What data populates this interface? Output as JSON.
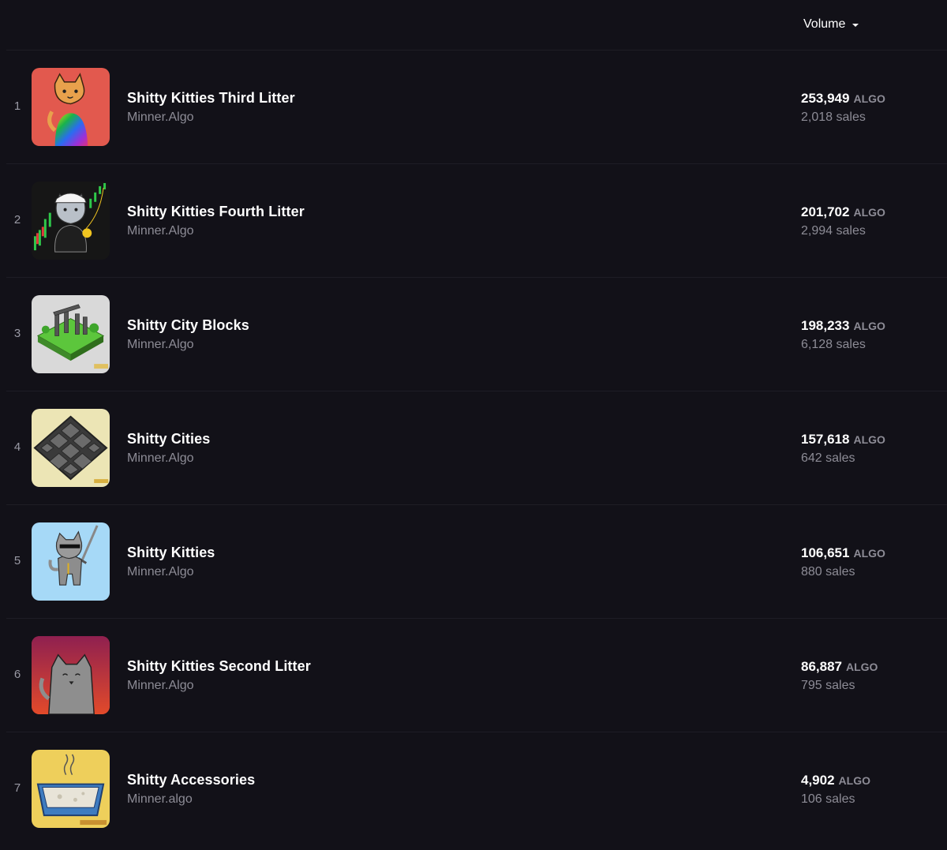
{
  "header": {
    "sort_label": "Volume"
  },
  "rows": [
    {
      "rank": "1",
      "name": "Shitty Kitties Third Litter",
      "creator": "Minner.Algo",
      "volume": "253,949",
      "unit": "ALGO",
      "sales": "2,018 sales",
      "thumb_color": "#e2594e",
      "icon": "rainbow-cat-thumbnail"
    },
    {
      "rank": "2",
      "name": "Shitty Kitties Fourth Litter",
      "creator": "Minner.Algo",
      "volume": "201,702",
      "unit": "ALGO",
      "sales": "2,994 sales",
      "thumb_color": "#161616",
      "icon": "trader-cat-thumbnail"
    },
    {
      "rank": "3",
      "name": "Shitty City Blocks",
      "creator": "Minner.Algo",
      "volume": "198,233",
      "unit": "ALGO",
      "sales": "6,128 sales",
      "thumb_color": "#d9d9d9",
      "icon": "city-block-thumbnail"
    },
    {
      "rank": "4",
      "name": "Shitty Cities",
      "creator": "Minner.Algo",
      "volume": "157,618",
      "unit": "ALGO",
      "sales": "642 sales",
      "thumb_color": "#ece5b5",
      "icon": "city-grid-thumbnail"
    },
    {
      "rank": "5",
      "name": "Shitty Kitties",
      "creator": "Minner.Algo",
      "volume": "106,651",
      "unit": "ALGO",
      "sales": "880 sales",
      "thumb_color": "#a6d9f7",
      "icon": "sword-cat-thumbnail"
    },
    {
      "rank": "6",
      "name": "Shitty Kitties Second Litter",
      "creator": "Minner.Algo",
      "volume": "86,887",
      "unit": "ALGO",
      "sales": "795 sales",
      "thumb_color": "#b8283f",
      "icon": "grey-cat-thumbnail"
    },
    {
      "rank": "7",
      "name": "Shitty Accessories",
      "creator": "Minner.algo",
      "volume": "4,902",
      "unit": "ALGO",
      "sales": "106 sales",
      "thumb_color": "#eecf5b",
      "icon": "litter-box-thumbnail"
    }
  ]
}
